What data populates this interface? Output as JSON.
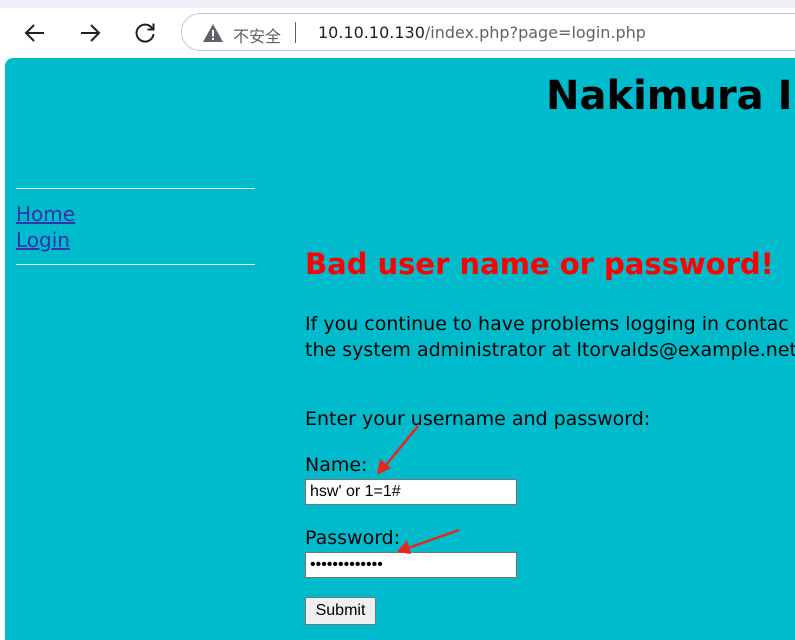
{
  "browser": {
    "security_label": "不安全",
    "url_host": "10.10.10.130",
    "url_path": "/index.php?page=login.php"
  },
  "site": {
    "title": "Nakimura In"
  },
  "sidebar": {
    "items": [
      {
        "label": "Home"
      },
      {
        "label": "Login"
      }
    ]
  },
  "login": {
    "error_heading": "Bad user name or password!",
    "help_line1": "If you continue to have problems logging in contac",
    "help_line2": "the system administrator at ltorvalds@example.net",
    "prompt": "Enter your username and password:",
    "name_label": "Name:",
    "name_value": "hsw' or 1=1#",
    "password_label": "Password:",
    "password_value": "•••••••••••••",
    "submit_label": "Submit"
  },
  "colors": {
    "page_background": "#00bbcc",
    "error_text": "#ff0000",
    "annotation_arrow": "#e8261c",
    "link": "#3333aa"
  }
}
